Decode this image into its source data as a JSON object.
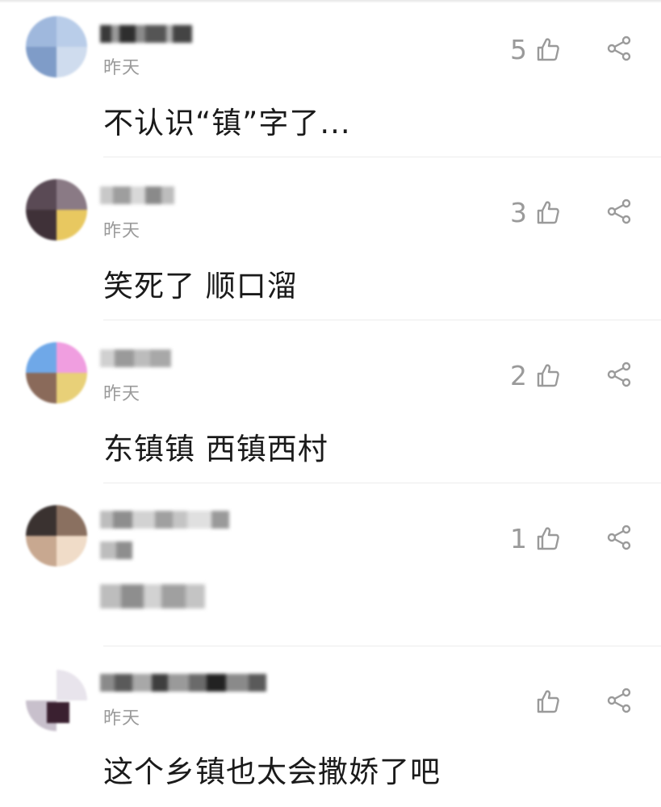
{
  "comments": [
    {
      "time": "昨天",
      "text": "不认识“镇”字了...",
      "likes": "5",
      "like_icon": "thumbs-up-outline",
      "share_icon": "share-nodes",
      "avatar_colors": [
        "#9fb8dd",
        "#b9cde9",
        "#7f9cc8",
        "#cfdcee"
      ],
      "name_colors": [
        "#3a3a3a",
        "#9a9a9a",
        "#2e2e2e",
        "#8a8a8a",
        "#555555",
        "#b0b0b0",
        "#444444"
      ]
    },
    {
      "time": "昨天",
      "text": "笑死了 顺口溜",
      "likes": "3",
      "like_icon": "thumbs-up-outline",
      "share_icon": "share-nodes",
      "avatar_colors": [
        "#5a4a55",
        "#8a7a85",
        "#e8c860",
        "#3f3138"
      ],
      "name_colors": [
        "#c8c8c8",
        "#9e9e9e",
        "#d8d8d8",
        "#8a8a8a",
        "#bdbdbd"
      ]
    },
    {
      "time": "昨天",
      "text": "东镇镇 西镇西村",
      "likes": "2",
      "like_icon": "thumbs-up-outline",
      "share_icon": "share-nodes",
      "avatar_colors": [
        "#6fa8e8",
        "#f09ee0",
        "#8a6a5a",
        "#e8d078"
      ],
      "name_colors": [
        "#d0d0d0",
        "#9a9a9a",
        "#bcbcbc",
        "#a8a8a8"
      ]
    },
    {
      "time": "",
      "text": "",
      "likes": "1",
      "like_icon": "thumbs-up-outline",
      "share_icon": "share-nodes",
      "avatar_colors": [
        "#3a3230",
        "#8a7060",
        "#f0dcc8",
        "#c8a890"
      ],
      "name_colors": [
        "#bdbdbd",
        "#8e8e8e",
        "#d2d2d2",
        "#a0a0a0",
        "#c4c4c4",
        "#e0e0e0",
        "#9a9a9a"
      ]
    },
    {
      "time": "昨天",
      "text": "这个乡镇也太会撒娇了吧",
      "likes": "",
      "like_icon": "thumbs-up-outline",
      "share_icon": "share-nodes",
      "avatar_colors": [
        "#ffffff",
        "#e8e4ec",
        "#3a2030",
        "#c8c0cc"
      ],
      "name_colors": [
        "#8a8a8a",
        "#5a5a5a",
        "#a8a8a8",
        "#3e3e3e",
        "#9a9a9a",
        "#6a6a6a",
        "#222222"
      ]
    }
  ],
  "colors": {
    "text": "#1a1a1a",
    "secondary": "#9a9a9a",
    "divider": "#ececec"
  }
}
